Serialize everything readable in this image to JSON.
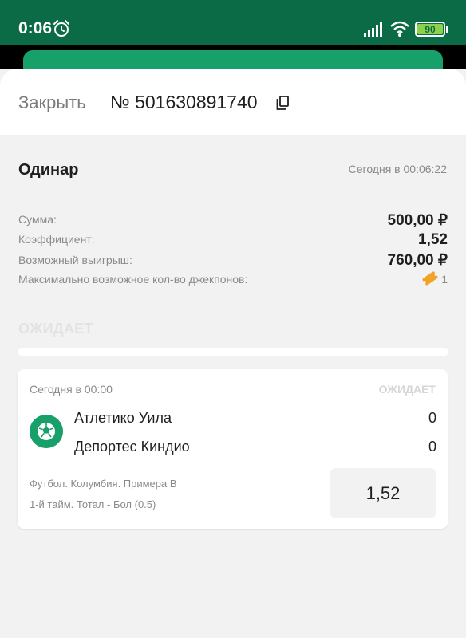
{
  "status_bar": {
    "time": "0:06",
    "battery": "90",
    "icons": [
      "alarm-icon",
      "signal-icon",
      "wifi-icon",
      "battery-icon"
    ]
  },
  "colors": {
    "brand_dark": "#0b6b47",
    "brand": "#17a069",
    "coupon": "#f0a324"
  },
  "header": {
    "close_label": "Закрыть",
    "ticket_number": "№ 501630891740"
  },
  "bet": {
    "type": "Одинар",
    "time": "Сегодня в 00:06:22",
    "rows": [
      {
        "label": "Сумма:",
        "value": "500,00 ₽"
      },
      {
        "label": "Коэффициент:",
        "value": "1,52"
      },
      {
        "label": "Возможный выигрыш:",
        "value": "760,00 ₽"
      }
    ],
    "jackpot_label": "Максимально возможное кол-во джекпонов:",
    "jackpot_count": "1",
    "status": "ОЖИДАЕТ"
  },
  "event": {
    "time": "Сегодня в 00:00",
    "status": "ОЖИДАЕТ",
    "team_home": "Атлетико Уила",
    "score_home": "0",
    "team_away": "Депортес Киндио",
    "score_away": "0",
    "league": "Футбол. Колумбия. Примера В",
    "market": "1-й тайм. Тотал - Бол (0.5)",
    "odds": "1,52"
  }
}
